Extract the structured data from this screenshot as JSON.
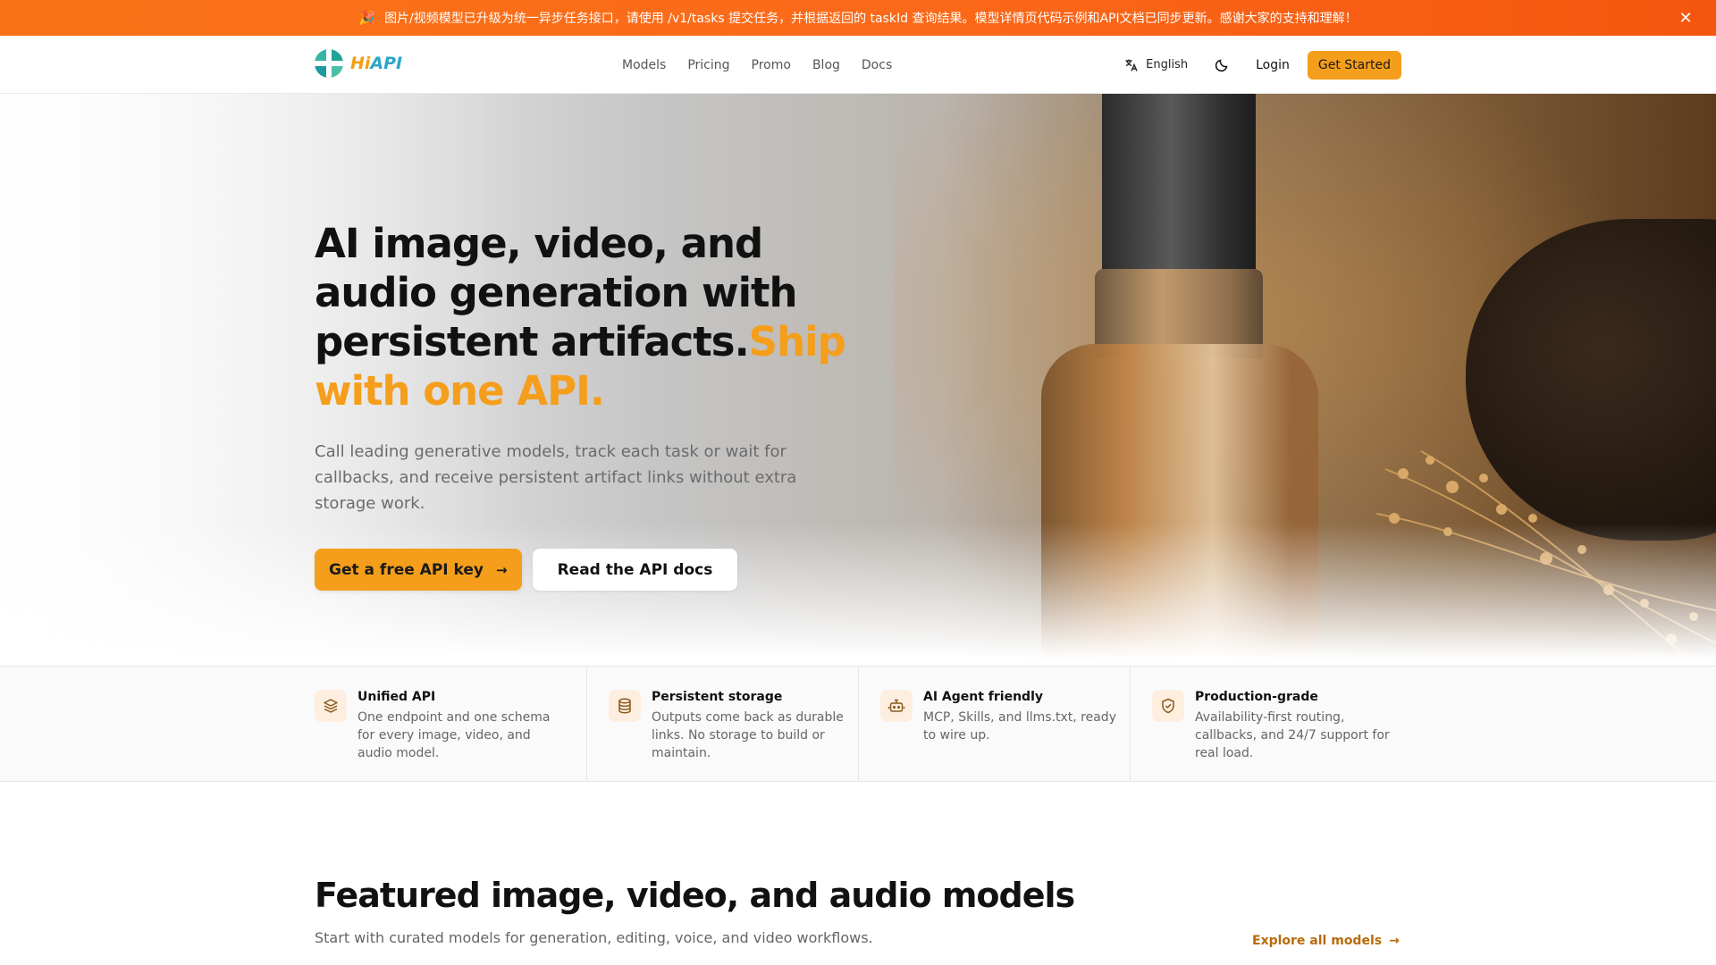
{
  "announcement": {
    "text": "图片/视频模型已升级为统一异步任务接口，请使用 /v1/tasks 提交任务，并根据返回的 taskId 查询结果。模型详情页代码示例和API文档已同步更新。感谢大家的支持和理解！",
    "close": "✕"
  },
  "nav": {
    "logo_hi": "Hi",
    "logo_api": "API",
    "links": [
      "Models",
      "Pricing",
      "Promo",
      "Blog",
      "Docs"
    ],
    "language": "English",
    "login": "Login",
    "get_started": "Get Started"
  },
  "hero": {
    "title_main": "AI image, video, and audio generation with persistent artifacts.",
    "title_accent": "Ship with one API.",
    "subtitle": "Call leading generative models, track each task or wait for callbacks, and receive persistent artifact links without extra storage work.",
    "primary_button": "Get a free API key",
    "secondary_button": "Read the API docs"
  },
  "features": [
    {
      "title": "Unified API",
      "description": "One endpoint and one schema for every image, video, and audio model.",
      "icon": "layers-icon"
    },
    {
      "title": "Persistent storage",
      "description": "Outputs come back as durable links. No storage to build or maintain.",
      "icon": "database-icon"
    },
    {
      "title": "AI Agent friendly",
      "description": "MCP, Skills, and llms.txt, ready to wire up.",
      "icon": "bot-icon"
    },
    {
      "title": "Production-grade",
      "description": "Availability-first routing, callbacks, and 24/7 support for real load.",
      "icon": "shield-check-icon"
    }
  ],
  "featured": {
    "title": "Featured image, video, and audio models",
    "subtitle": "Start with curated models for generation, editing, voice, and video workflows.",
    "explore": "Explore all models"
  },
  "colors": {
    "accent": "#f59e1b",
    "banner": "#f97316",
    "brand_teal": "#2ba6c6"
  }
}
